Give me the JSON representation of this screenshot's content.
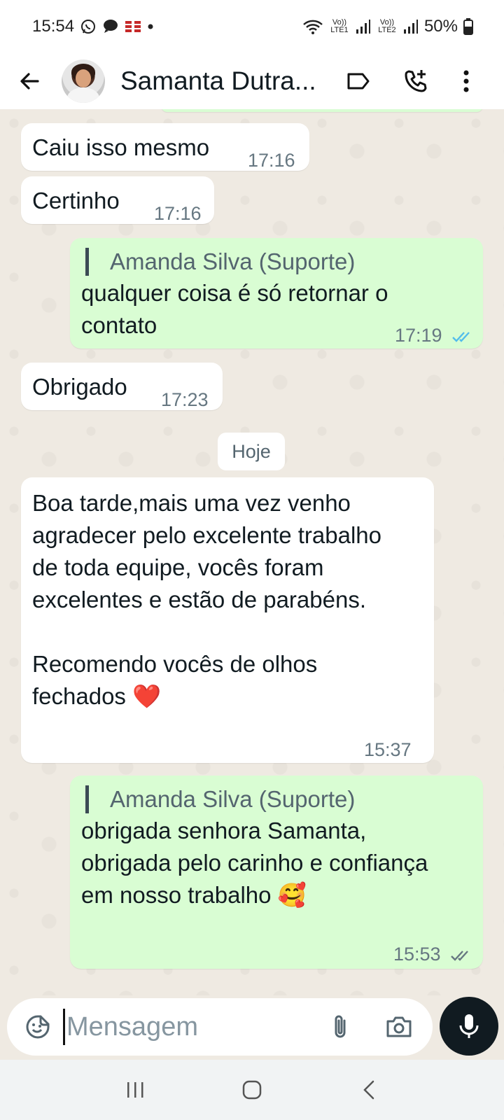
{
  "status_bar": {
    "time": "15:54",
    "sim1_label": "Vo)) LTE1",
    "sim2_label": "Vo)) LTE2",
    "battery": "50%"
  },
  "header": {
    "contact_name": "Samanta Dutra..."
  },
  "messages": [
    {
      "direction": "in",
      "text": "Caiu isso mesmo",
      "time": "17:16"
    },
    {
      "direction": "in",
      "text": "Certinho",
      "time": "17:16"
    },
    {
      "direction": "out",
      "sender": "Amanda Silva (Suporte)",
      "text": "qualquer coisa é só retornar o contato",
      "time": "17:19",
      "status": "read"
    },
    {
      "direction": "in",
      "text": "Obrigado",
      "time": "17:23"
    },
    {
      "direction": "in",
      "text": "Boa tarde,mais uma vez venho agradecer pelo excelente trabalho de toda equipe, vocês foram excelentes e estão de parabéns.\n\nRecomendo vocês de olhos fechados ❤️",
      "time": "15:37"
    },
    {
      "direction": "out",
      "sender": "Amanda Silva (Suporte)",
      "text": "obrigada senhora Samanta, obrigada pelo carinho e confiança em nosso trabalho 🥰",
      "time": "15:53",
      "status": "delivered"
    }
  ],
  "day_separator": "Hoje",
  "composer": {
    "placeholder": "Mensagem"
  },
  "colors": {
    "incoming_bubble": "#ffffff",
    "outgoing_bubble": "#d9fdd3",
    "read_tick": "#53bdeb",
    "chat_background": "#efeae2"
  }
}
